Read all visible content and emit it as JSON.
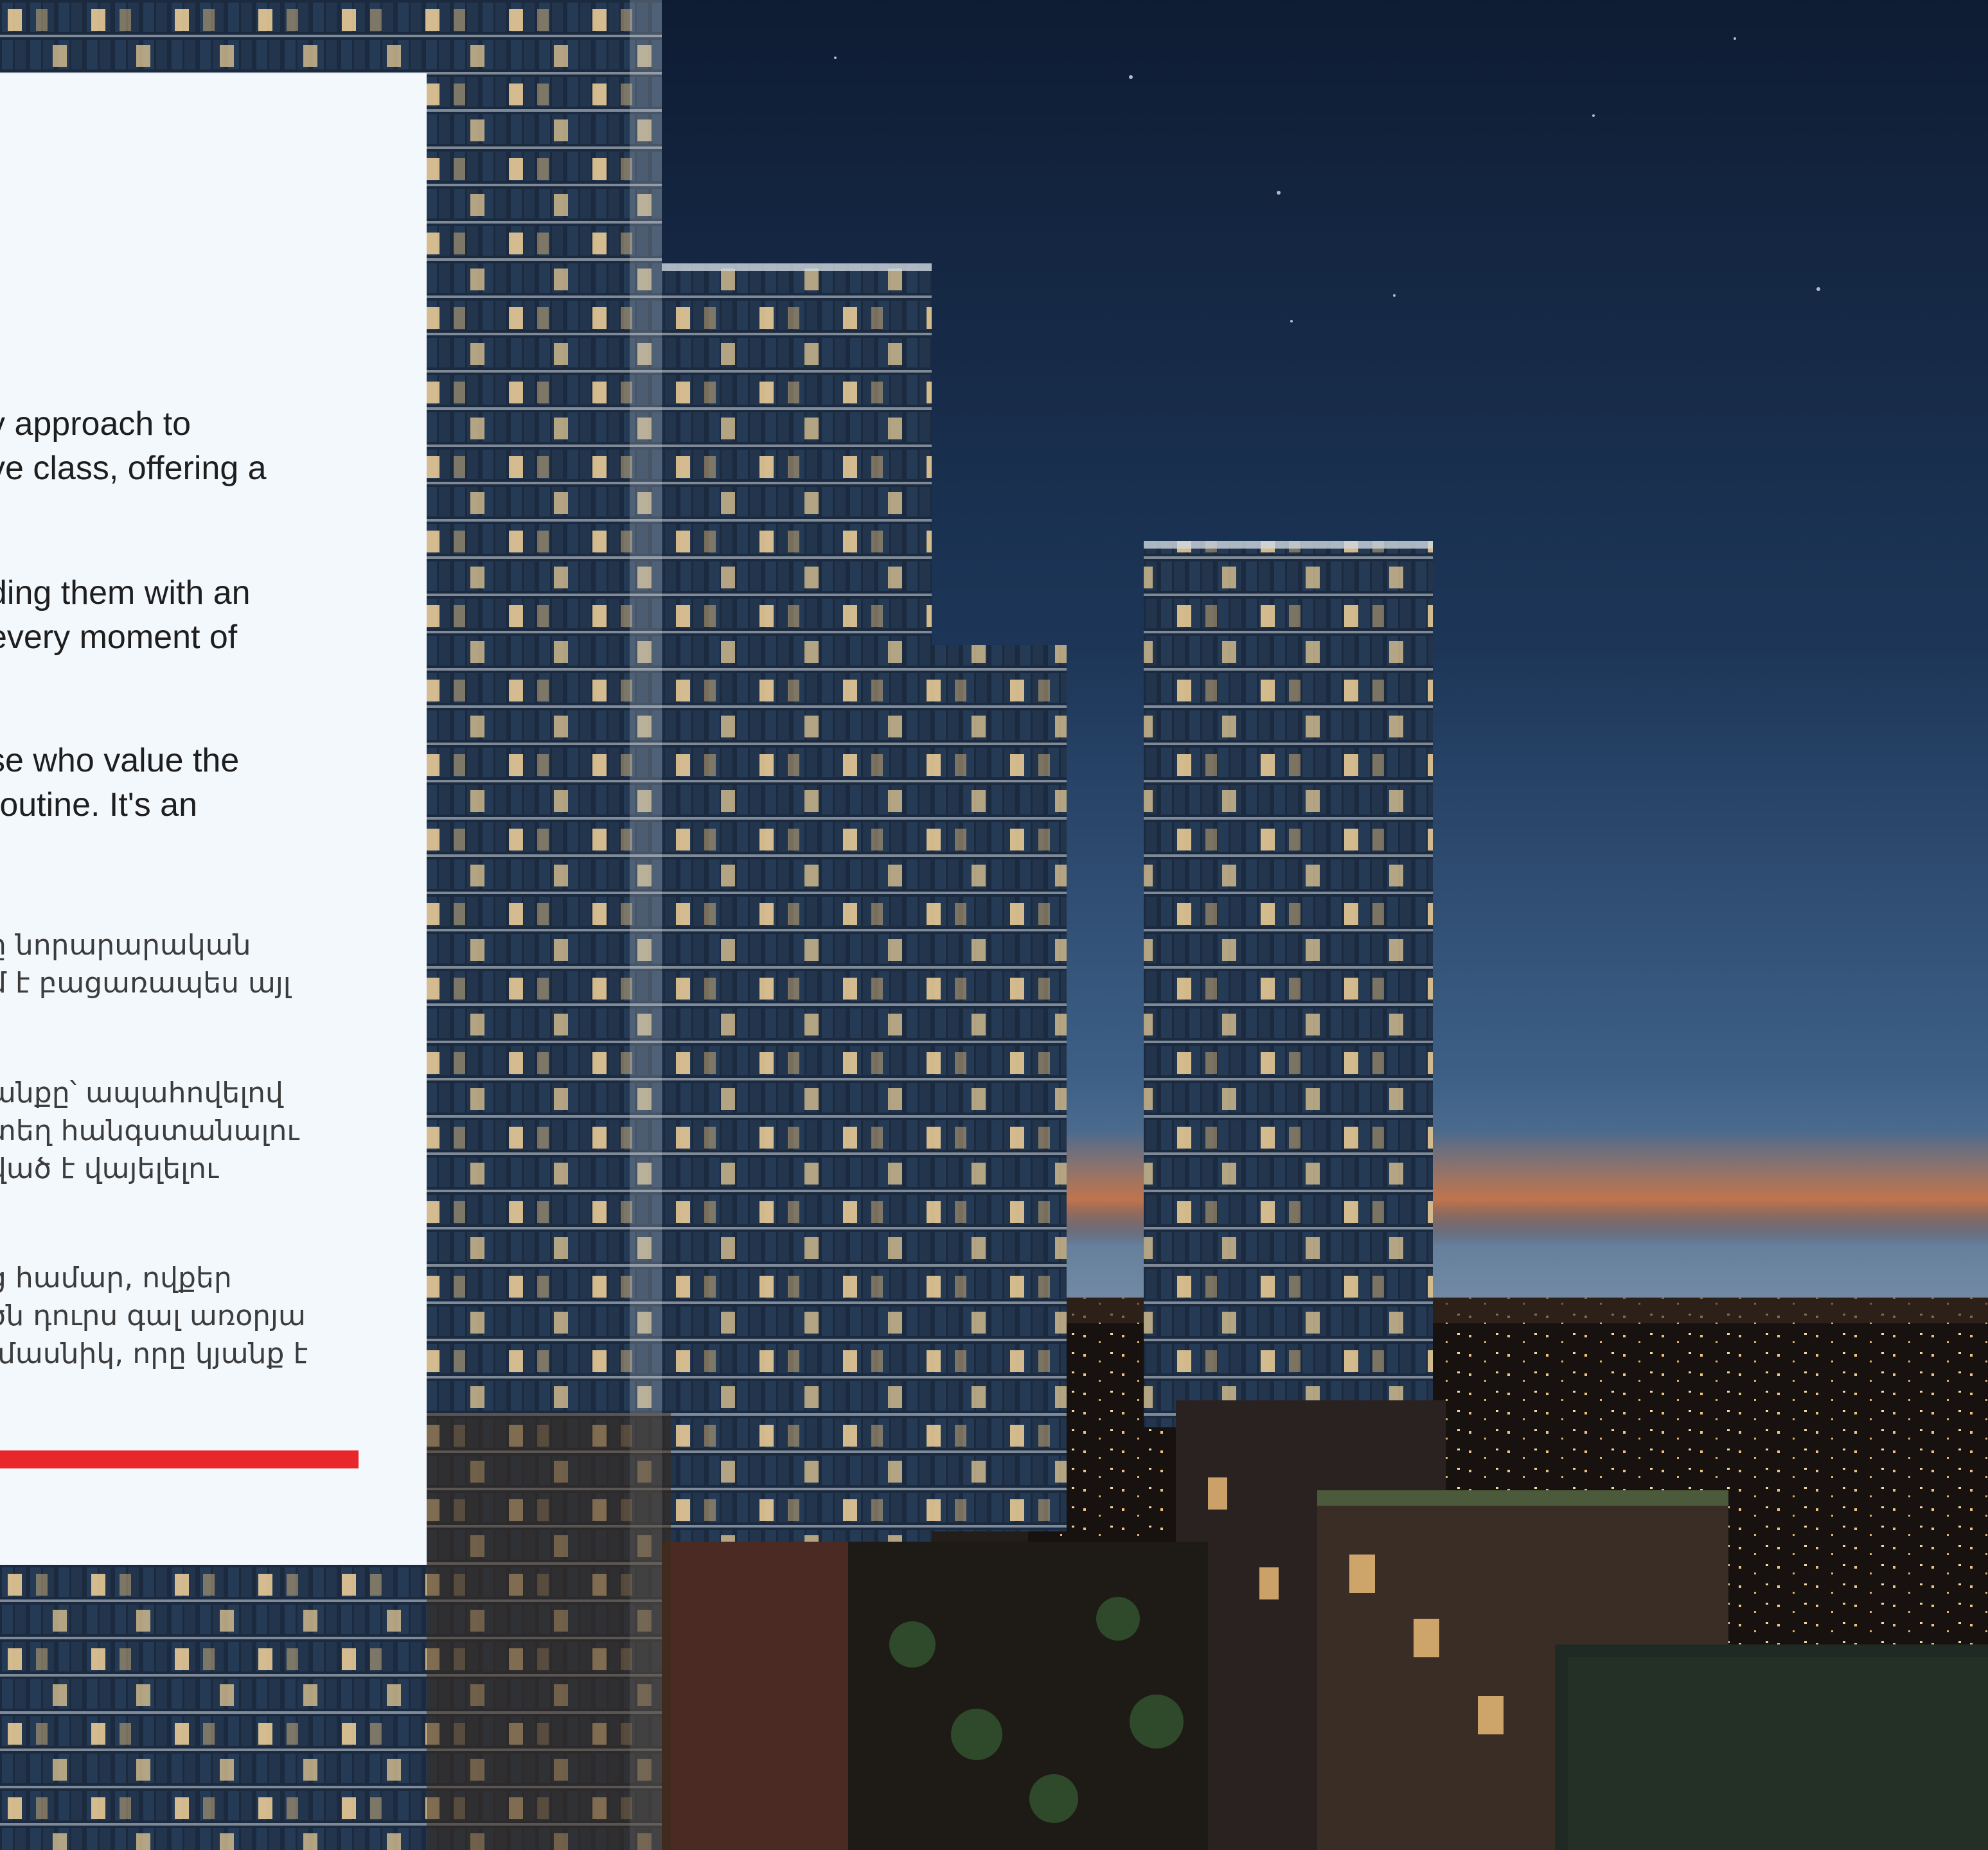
{
  "photo": {
    "colors": {
      "sky_top": "#0e1c33",
      "sky_mid": "#2a4a6e",
      "sky_horizon": "#6f86a0",
      "sunset_glow": "#d9743a",
      "city_ground": "#1a1410",
      "facade": "#1c2a3d",
      "window_light": "#f2d39a",
      "frame_light": "#cfd8e0"
    }
  },
  "panel": {
    "english_paragraphs": [
      "y approach to\nve class, offering a",
      "ding them with an\nevery moment of",
      "se who value the\nroutine. It's an\n."
    ],
    "armenian_paragraphs": [
      "ը նորարարական\nմ է բացառապես այլ",
      "անքը՝ ապահովելով\nտեղ հանգստանալու\nված է վայելելու",
      "ց համար, ովքեր\nծն դուրս գալ առօրյա\n մասնիկ, որը կյանք է"
    ],
    "accent_color": "#e8262b"
  }
}
